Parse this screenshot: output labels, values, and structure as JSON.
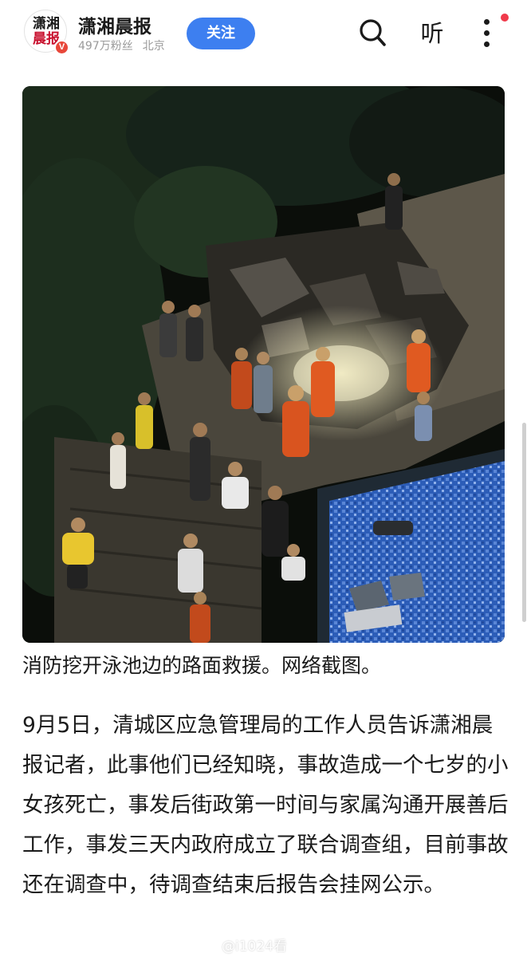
{
  "header": {
    "account_name": "潇湘晨报",
    "logo_text_line1": "潇湘",
    "logo_text_line2": "晨报",
    "verified_mark": "V",
    "followers": "497万粉丝",
    "location": "北京",
    "follow_label": "关注",
    "listen_label": "听"
  },
  "icons": {
    "search": "search-icon",
    "more": "more-vertical-icon",
    "notification": "notification-dot"
  },
  "colors": {
    "follow_button": "#3d7ff0",
    "notification_dot": "#f03a4b",
    "verified_badge": "#e8473a",
    "pool_water": "#2f62c4"
  },
  "article": {
    "photo_caption": "消防挖开泳池边的路面救援。网络截图。",
    "paragraph": "9月5日，清城区应急管理局的工作人员告诉潇湘晨报记者，此事他们已经知晓，事故造成一个七岁的小女孩死亡，事发后街政第一时间与家属沟通开展善后工作，事发三天内政府成立了联合调查组，目前事故还在调查中，待调查结束后报告会挂网公示。"
  },
  "watermark": "@i1024看"
}
